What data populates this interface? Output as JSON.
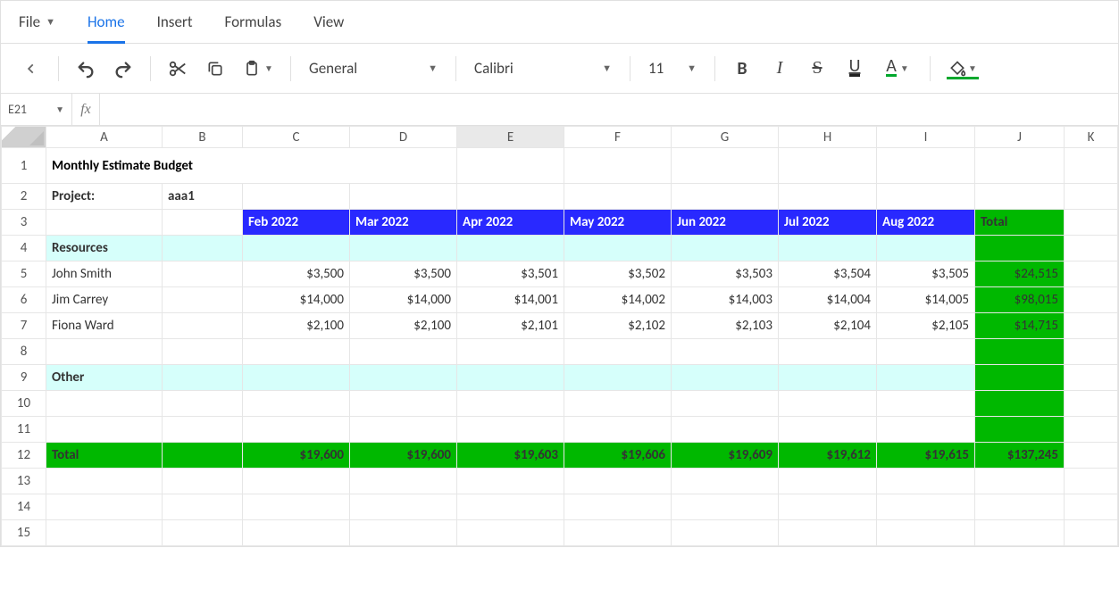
{
  "menu": {
    "file": "File",
    "home": "Home",
    "insert": "Insert",
    "formulas": "Formulas",
    "view": "View"
  },
  "toolbar": {
    "numfmt": "General",
    "font": "Calibri",
    "size": "11"
  },
  "namebox": {
    "ref": "E21"
  },
  "columns": [
    "A",
    "B",
    "C",
    "D",
    "E",
    "F",
    "G",
    "H",
    "I",
    "J",
    "K"
  ],
  "selectedCol": "E",
  "rows": [
    "1",
    "2",
    "3",
    "4",
    "5",
    "6",
    "7",
    "8",
    "9",
    "10",
    "11",
    "12",
    "13",
    "14",
    "15"
  ],
  "sheet": {
    "title": "Monthly Estimate Budget",
    "projectLabel": "Project:",
    "projectName": "aaa1",
    "months": [
      "Feb 2022",
      "Mar 2022",
      "Apr 2022",
      "May 2022",
      "Jun 2022",
      "Jul 2022",
      "Aug 2022"
    ],
    "totalLabel": "Total",
    "resourcesLabel": "Resources",
    "otherLabel": "Other",
    "rowTotalLabel": "Total",
    "people": [
      {
        "name": "John Smith",
        "vals": [
          "$3,500",
          "$3,500",
          "$3,501",
          "$3,502",
          "$3,503",
          "$3,504",
          "$3,505"
        ],
        "total": "$24,515"
      },
      {
        "name": "Jim Carrey",
        "vals": [
          "$14,000",
          "$14,000",
          "$14,001",
          "$14,002",
          "$14,003",
          "$14,004",
          "$14,005"
        ],
        "total": "$98,015"
      },
      {
        "name": "Fiona Ward",
        "vals": [
          "$2,100",
          "$2,100",
          "$2,101",
          "$2,102",
          "$2,103",
          "$2,104",
          "$2,105"
        ],
        "total": "$14,715"
      }
    ],
    "colTotals": [
      "$19,600",
      "$19,600",
      "$19,603",
      "$19,606",
      "$19,609",
      "$19,612",
      "$19,615"
    ],
    "grandTotal": "$137,245"
  }
}
